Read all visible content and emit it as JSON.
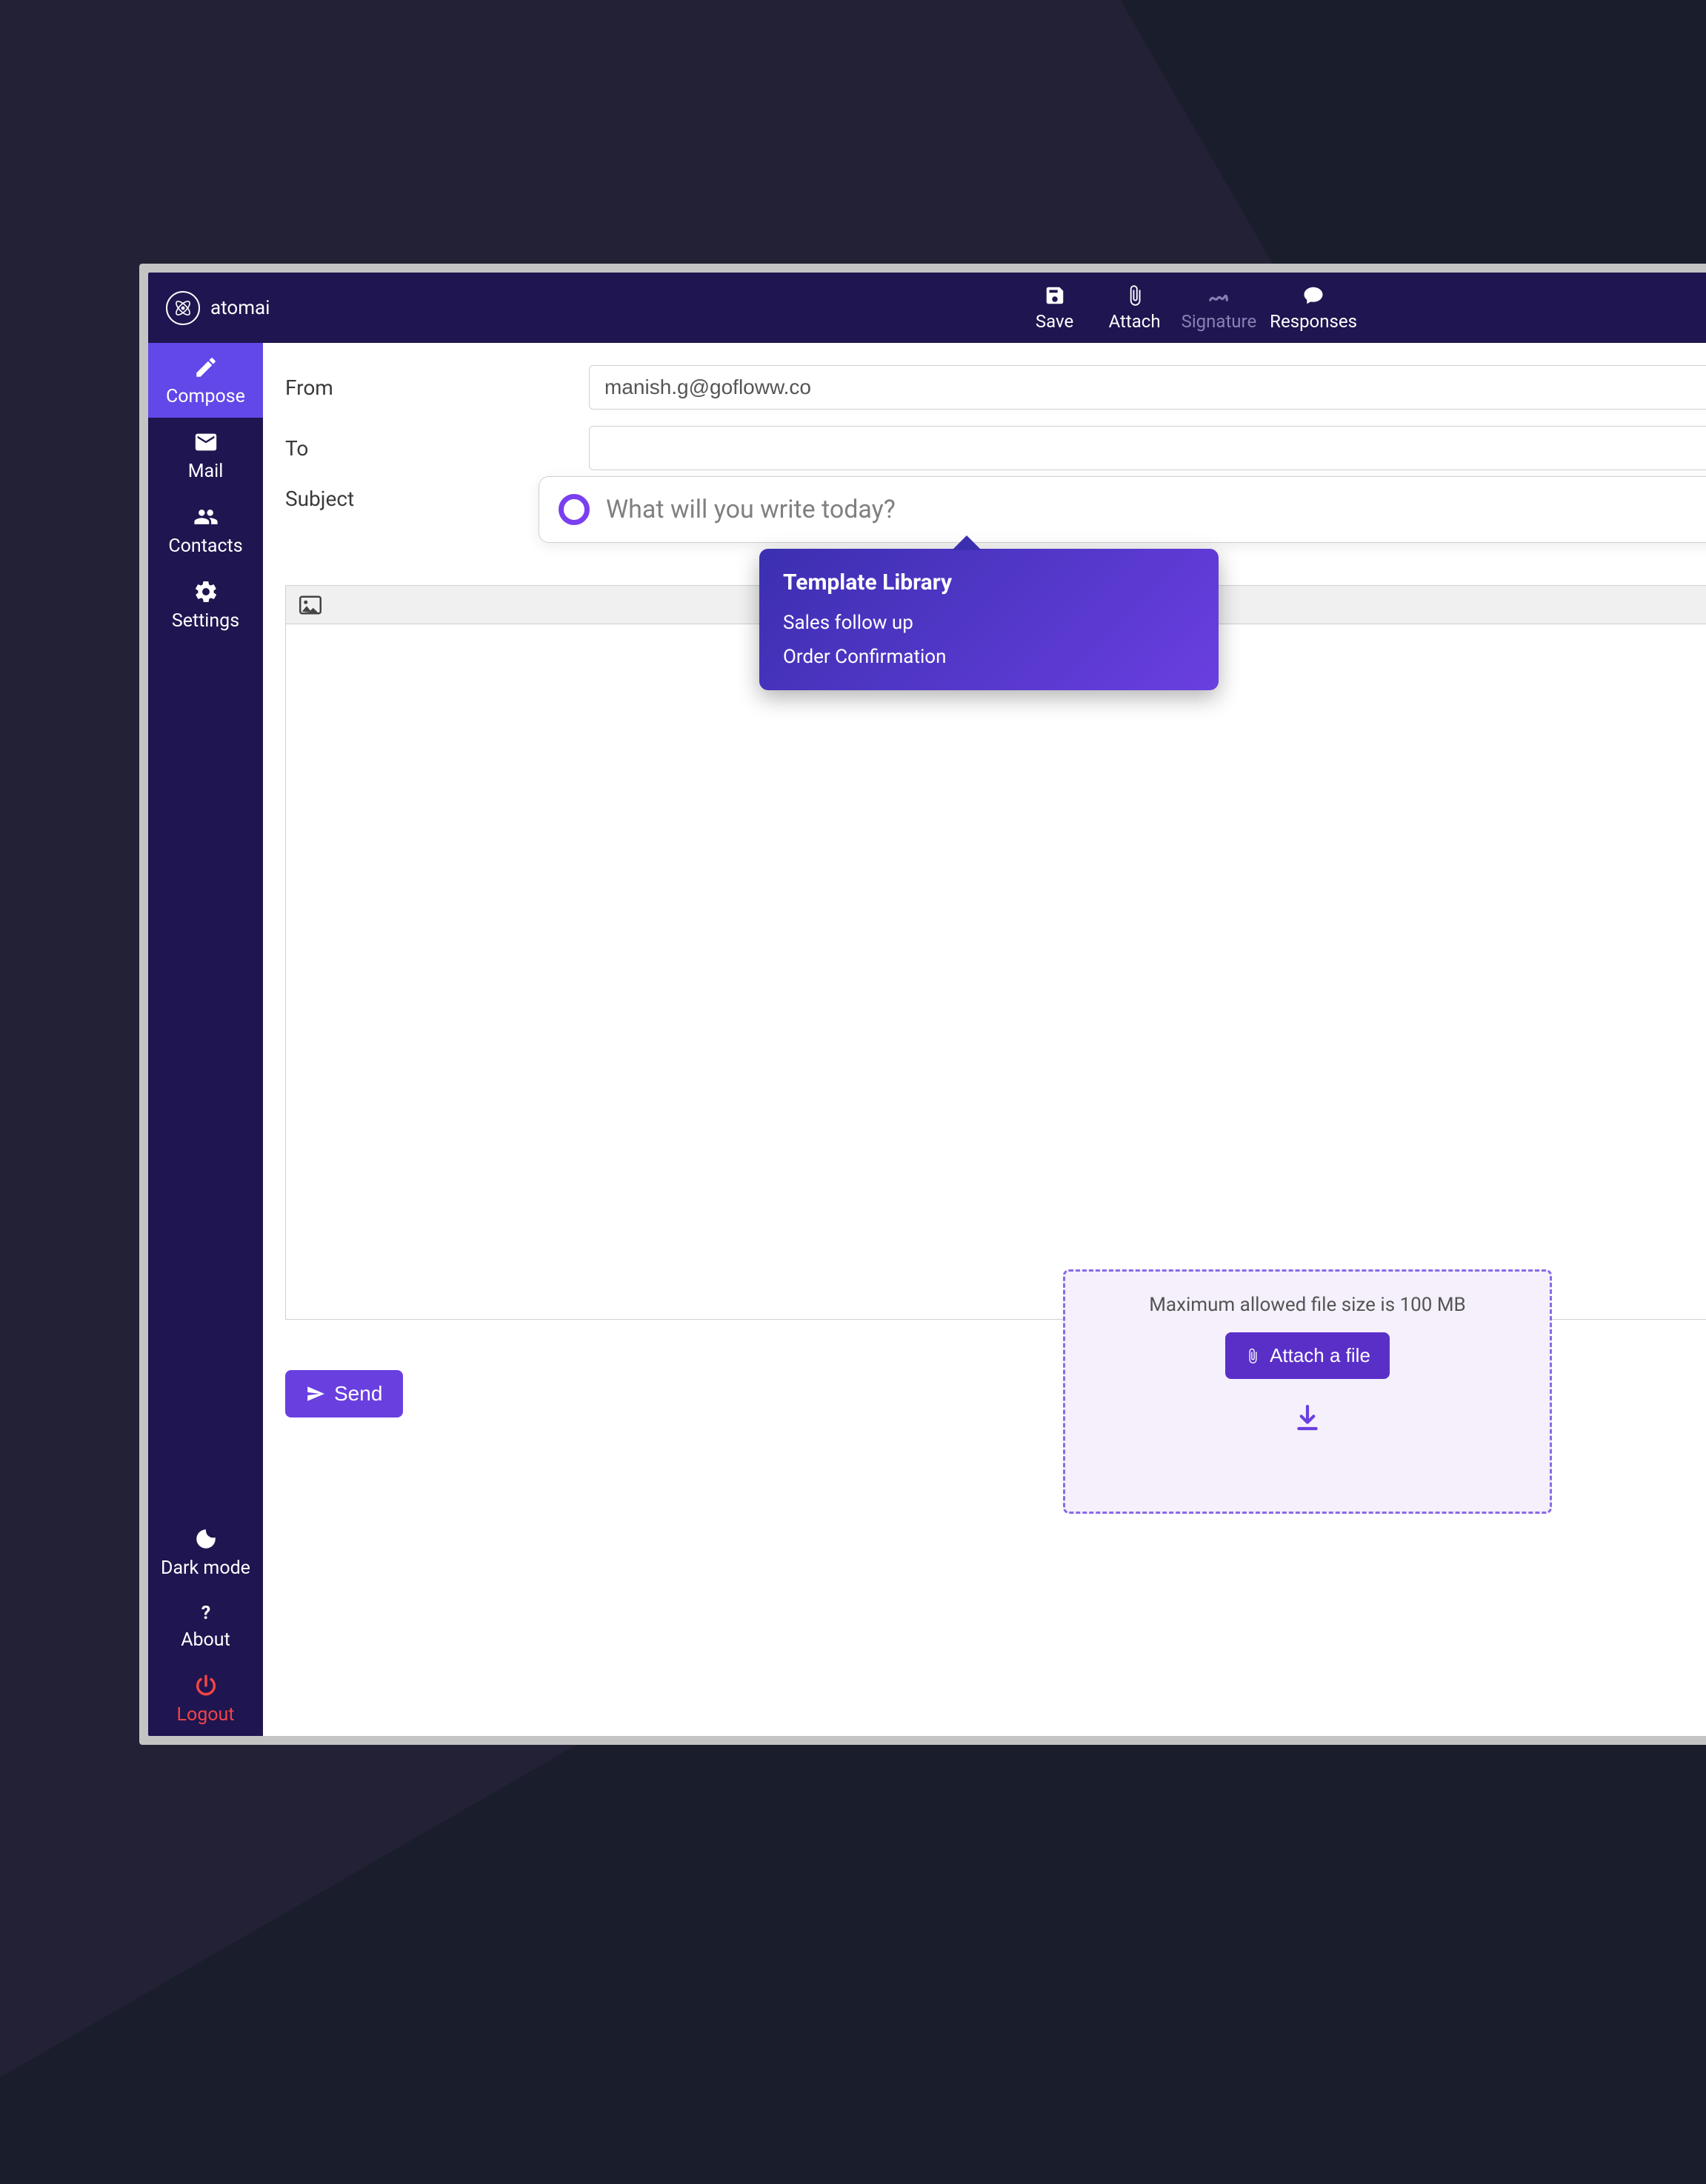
{
  "brand": {
    "name": "atomai"
  },
  "toolbar": {
    "save": "Save",
    "attach": "Attach",
    "signature": "Signature",
    "responses": "Responses"
  },
  "sidebar": {
    "compose": "Compose",
    "mail": "Mail",
    "contacts": "Contacts",
    "settings": "Settings",
    "darkmode": "Dark mode",
    "about": "About",
    "logout": "Logout"
  },
  "compose": {
    "from_label": "From",
    "from_value": "manish.g@gofloww.co",
    "to_label": "To",
    "to_value": "",
    "subject_label": "Subject",
    "prompt_placeholder": "What will you write today?"
  },
  "template_popover": {
    "title": "Template Library",
    "items": [
      "Sales follow up",
      "Order Confirmation"
    ]
  },
  "send_button": "Send",
  "attach_zone": {
    "hint": "Maximum allowed  file size is 100 MB",
    "button": "Attach a file"
  }
}
